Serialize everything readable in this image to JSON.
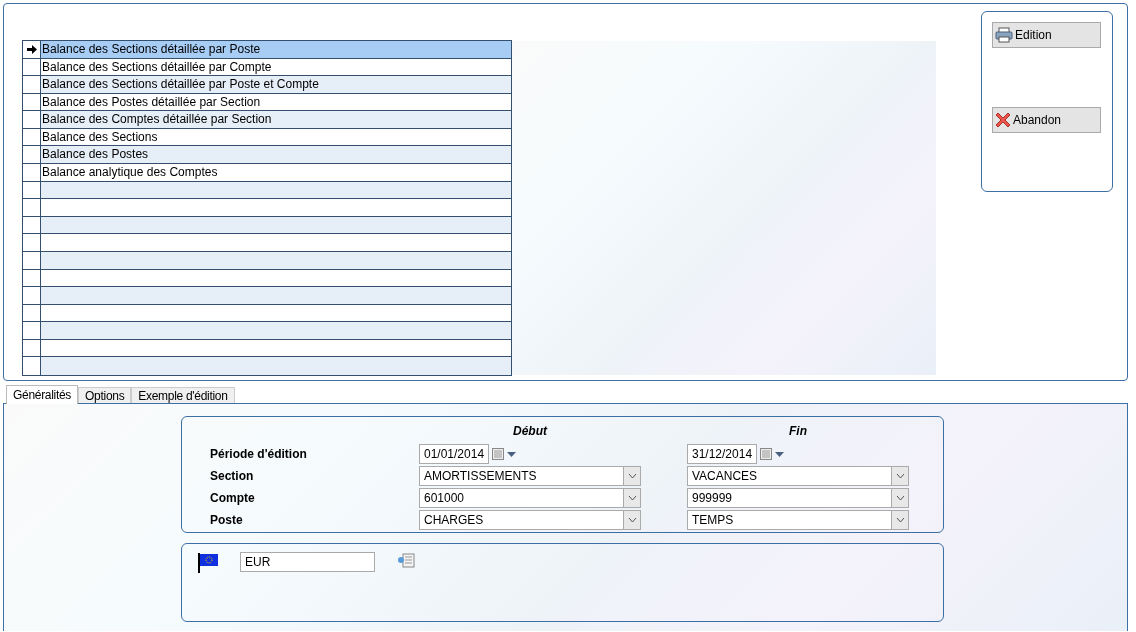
{
  "report_list": [
    {
      "label": "Balance des Sections détaillée par Poste",
      "selected": true
    },
    {
      "label": "Balance des Sections détaillée par Compte",
      "selected": false
    },
    {
      "label": "Balance des Sections détaillée par Poste et Compte",
      "selected": false
    },
    {
      "label": "Balance des Postes détaillée par Section",
      "selected": false
    },
    {
      "label": "Balance des Comptes détaillée par Section",
      "selected": false
    },
    {
      "label": "Balance des Sections",
      "selected": false
    },
    {
      "label": "Balance des Postes",
      "selected": false
    },
    {
      "label": "Balance analytique des Comptes",
      "selected": false
    }
  ],
  "buttons": [
    {
      "kind": "print",
      "label": "Edition"
    },
    {
      "kind": "cancel",
      "label": "Abandon"
    }
  ],
  "tabs": [
    {
      "label": "Généralités",
      "selected": true
    },
    {
      "label": "Options",
      "selected": false
    },
    {
      "label": "Exemple d'édition",
      "selected": false
    }
  ],
  "criteria": {
    "start_header": "Début",
    "end_header": "Fin",
    "rows": [
      {
        "kind": "date",
        "label": "Période d'édition",
        "start": "01/01/2014",
        "end": "31/12/2014"
      },
      {
        "kind": "combo",
        "label": "Section",
        "start": "AMORTISSEMENTS",
        "end": "VACANCES"
      },
      {
        "kind": "combo",
        "label": "Compte",
        "start": "601000",
        "end": "999999"
      },
      {
        "kind": "combo",
        "label": "Poste",
        "start": "CHARGES",
        "end": "TEMPS"
      }
    ]
  },
  "currency": {
    "code": "EUR"
  }
}
